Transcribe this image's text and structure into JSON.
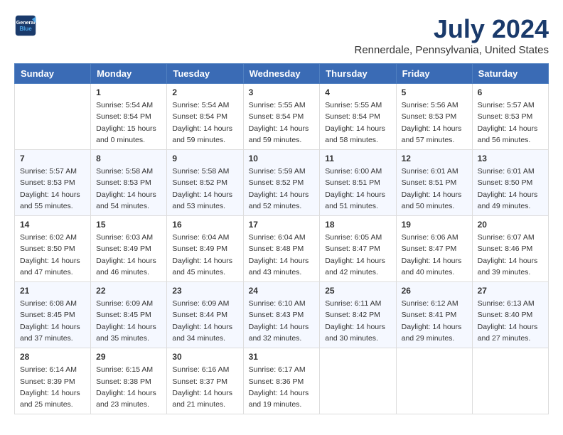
{
  "logo": {
    "line1": "General",
    "line2": "Blue"
  },
  "title": "July 2024",
  "location": "Rennerdale, Pennsylvania, United States",
  "days_of_week": [
    "Sunday",
    "Monday",
    "Tuesday",
    "Wednesday",
    "Thursday",
    "Friday",
    "Saturday"
  ],
  "weeks": [
    [
      {
        "day": "",
        "info": ""
      },
      {
        "day": "1",
        "info": "Sunrise: 5:54 AM\nSunset: 8:54 PM\nDaylight: 15 hours\nand 0 minutes."
      },
      {
        "day": "2",
        "info": "Sunrise: 5:54 AM\nSunset: 8:54 PM\nDaylight: 14 hours\nand 59 minutes."
      },
      {
        "day": "3",
        "info": "Sunrise: 5:55 AM\nSunset: 8:54 PM\nDaylight: 14 hours\nand 59 minutes."
      },
      {
        "day": "4",
        "info": "Sunrise: 5:55 AM\nSunset: 8:54 PM\nDaylight: 14 hours\nand 58 minutes."
      },
      {
        "day": "5",
        "info": "Sunrise: 5:56 AM\nSunset: 8:53 PM\nDaylight: 14 hours\nand 57 minutes."
      },
      {
        "day": "6",
        "info": "Sunrise: 5:57 AM\nSunset: 8:53 PM\nDaylight: 14 hours\nand 56 minutes."
      }
    ],
    [
      {
        "day": "7",
        "info": "Sunrise: 5:57 AM\nSunset: 8:53 PM\nDaylight: 14 hours\nand 55 minutes."
      },
      {
        "day": "8",
        "info": "Sunrise: 5:58 AM\nSunset: 8:53 PM\nDaylight: 14 hours\nand 54 minutes."
      },
      {
        "day": "9",
        "info": "Sunrise: 5:58 AM\nSunset: 8:52 PM\nDaylight: 14 hours\nand 53 minutes."
      },
      {
        "day": "10",
        "info": "Sunrise: 5:59 AM\nSunset: 8:52 PM\nDaylight: 14 hours\nand 52 minutes."
      },
      {
        "day": "11",
        "info": "Sunrise: 6:00 AM\nSunset: 8:51 PM\nDaylight: 14 hours\nand 51 minutes."
      },
      {
        "day": "12",
        "info": "Sunrise: 6:01 AM\nSunset: 8:51 PM\nDaylight: 14 hours\nand 50 minutes."
      },
      {
        "day": "13",
        "info": "Sunrise: 6:01 AM\nSunset: 8:50 PM\nDaylight: 14 hours\nand 49 minutes."
      }
    ],
    [
      {
        "day": "14",
        "info": "Sunrise: 6:02 AM\nSunset: 8:50 PM\nDaylight: 14 hours\nand 47 minutes."
      },
      {
        "day": "15",
        "info": "Sunrise: 6:03 AM\nSunset: 8:49 PM\nDaylight: 14 hours\nand 46 minutes."
      },
      {
        "day": "16",
        "info": "Sunrise: 6:04 AM\nSunset: 8:49 PM\nDaylight: 14 hours\nand 45 minutes."
      },
      {
        "day": "17",
        "info": "Sunrise: 6:04 AM\nSunset: 8:48 PM\nDaylight: 14 hours\nand 43 minutes."
      },
      {
        "day": "18",
        "info": "Sunrise: 6:05 AM\nSunset: 8:47 PM\nDaylight: 14 hours\nand 42 minutes."
      },
      {
        "day": "19",
        "info": "Sunrise: 6:06 AM\nSunset: 8:47 PM\nDaylight: 14 hours\nand 40 minutes."
      },
      {
        "day": "20",
        "info": "Sunrise: 6:07 AM\nSunset: 8:46 PM\nDaylight: 14 hours\nand 39 minutes."
      }
    ],
    [
      {
        "day": "21",
        "info": "Sunrise: 6:08 AM\nSunset: 8:45 PM\nDaylight: 14 hours\nand 37 minutes."
      },
      {
        "day": "22",
        "info": "Sunrise: 6:09 AM\nSunset: 8:45 PM\nDaylight: 14 hours\nand 35 minutes."
      },
      {
        "day": "23",
        "info": "Sunrise: 6:09 AM\nSunset: 8:44 PM\nDaylight: 14 hours\nand 34 minutes."
      },
      {
        "day": "24",
        "info": "Sunrise: 6:10 AM\nSunset: 8:43 PM\nDaylight: 14 hours\nand 32 minutes."
      },
      {
        "day": "25",
        "info": "Sunrise: 6:11 AM\nSunset: 8:42 PM\nDaylight: 14 hours\nand 30 minutes."
      },
      {
        "day": "26",
        "info": "Sunrise: 6:12 AM\nSunset: 8:41 PM\nDaylight: 14 hours\nand 29 minutes."
      },
      {
        "day": "27",
        "info": "Sunrise: 6:13 AM\nSunset: 8:40 PM\nDaylight: 14 hours\nand 27 minutes."
      }
    ],
    [
      {
        "day": "28",
        "info": "Sunrise: 6:14 AM\nSunset: 8:39 PM\nDaylight: 14 hours\nand 25 minutes."
      },
      {
        "day": "29",
        "info": "Sunrise: 6:15 AM\nSunset: 8:38 PM\nDaylight: 14 hours\nand 23 minutes."
      },
      {
        "day": "30",
        "info": "Sunrise: 6:16 AM\nSunset: 8:37 PM\nDaylight: 14 hours\nand 21 minutes."
      },
      {
        "day": "31",
        "info": "Sunrise: 6:17 AM\nSunset: 8:36 PM\nDaylight: 14 hours\nand 19 minutes."
      },
      {
        "day": "",
        "info": ""
      },
      {
        "day": "",
        "info": ""
      },
      {
        "day": "",
        "info": ""
      }
    ]
  ]
}
